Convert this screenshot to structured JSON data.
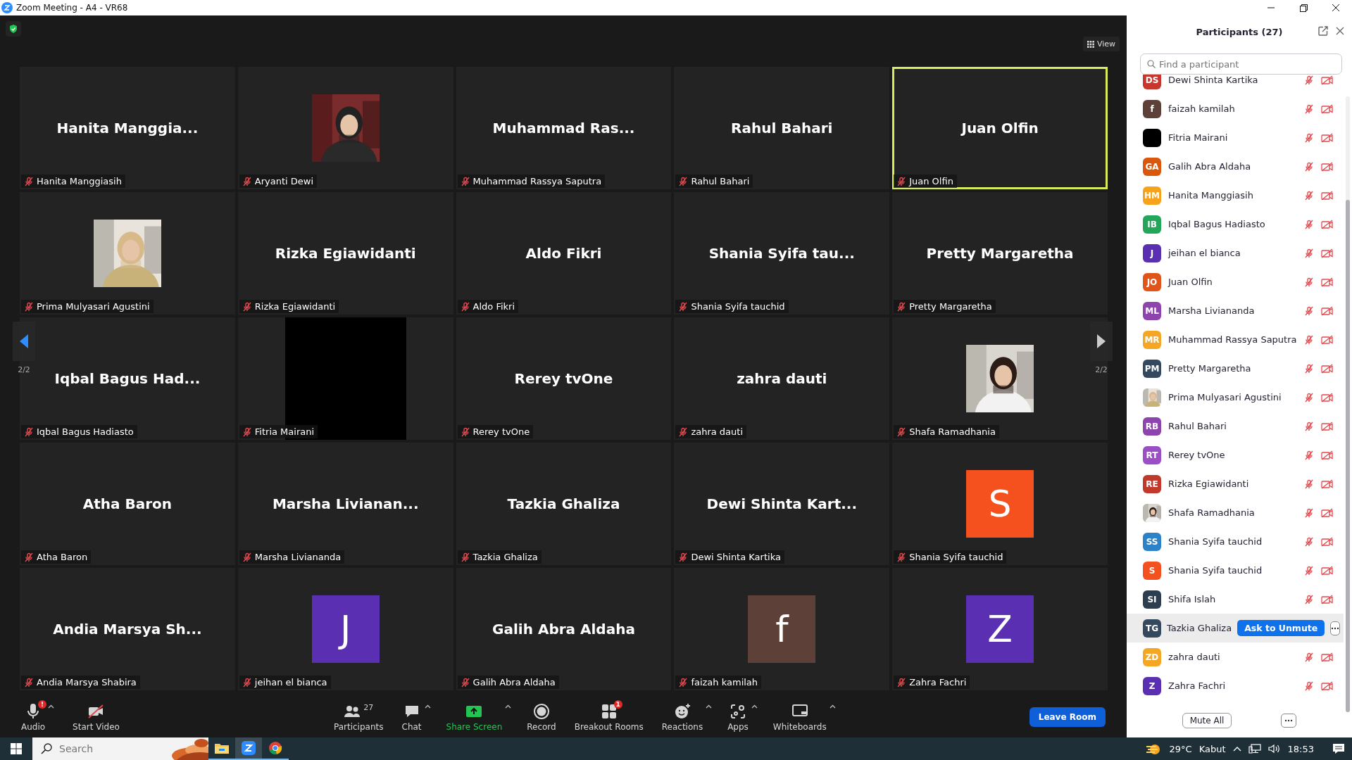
{
  "window": {
    "title": "Zoom Meeting - A4 - VR68"
  },
  "view_button": "View",
  "pager": {
    "left": "2/2",
    "right": "2/2"
  },
  "tiles": [
    {
      "kind": "name",
      "display": "Hanita Manggia...",
      "name": "Hanita Manggiasih",
      "muted": true,
      "speaking": false
    },
    {
      "name": "Aryanti Dewi",
      "muted": true,
      "speaking": false
    },
    {
      "kind": "name",
      "display": "Muhammad Ras...",
      "name": "Muhammad Rassya Saputra",
      "muted": true,
      "speaking": false
    },
    {
      "kind": "name",
      "display": "Rahul Bahari",
      "name": "Rahul Bahari",
      "muted": true,
      "speaking": false
    },
    {
      "kind": "name",
      "display": "Juan Olfin",
      "name": "Juan Olfin",
      "muted": true,
      "speaking": true
    },
    {
      "name": "Prima Mulyasari Agustini",
      "muted": true,
      "speaking": false
    },
    {
      "kind": "name",
      "display": "Rizka Egiawidanti",
      "name": "Rizka Egiawidanti",
      "muted": true,
      "speaking": false
    },
    {
      "kind": "name",
      "display": "Aldo Fikri",
      "name": "Aldo Fikri",
      "muted": true,
      "speaking": false
    },
    {
      "kind": "name",
      "display": "Shania Syifa tau...",
      "name": "Shania Syifa tauchid",
      "muted": true,
      "speaking": false
    },
    {
      "kind": "name",
      "display": "Pretty Margaretha",
      "name": "Pretty Margaretha",
      "muted": true,
      "speaking": false
    },
    {
      "kind": "name",
      "display": "Iqbal Bagus Had...",
      "name": "Iqbal Bagus Hadiasto",
      "muted": true,
      "speaking": false
    },
    {
      "kind": "black",
      "name": "Fitria Mairani",
      "muted": true,
      "speaking": false
    },
    {
      "kind": "name",
      "display": "Rerey tvOne",
      "name": "Rerey tvOne",
      "muted": true,
      "speaking": false
    },
    {
      "kind": "name",
      "display": "zahra dauti",
      "name": "zahra dauti",
      "muted": true,
      "speaking": false
    },
    {
      "name": "Shafa Ramadhania",
      "muted": true,
      "speaking": false
    },
    {
      "kind": "name",
      "display": "Atha Baron",
      "name": "Atha Baron",
      "muted": true,
      "speaking": false
    },
    {
      "kind": "name",
      "display": "Marsha Livianan...",
      "name": "Marsha Liviananda",
      "muted": true,
      "speaking": false
    },
    {
      "kind": "name",
      "display": "Tazkia Ghaliza",
      "name": "Tazkia Ghaliza",
      "muted": true,
      "speaking": false
    },
    {
      "kind": "name",
      "display": "Dewi Shinta Kart...",
      "name": "Dewi Shinta Kartika",
      "muted": true,
      "speaking": false
    },
    {
      "kind": "letter",
      "letter": "S",
      "color": "#f4511e",
      "name": "Shania Syifa tauchid",
      "muted": true,
      "speaking": false
    },
    {
      "kind": "name",
      "display": "Andia Marsya Sh...",
      "name": "Andia Marsya Shabira",
      "muted": true,
      "speaking": false
    },
    {
      "kind": "letter",
      "letter": "J",
      "color": "#5b2fb1",
      "name": "jeihan el bianca",
      "muted": true,
      "speaking": false
    },
    {
      "kind": "name",
      "display": "Galih Abra Aldaha",
      "name": "Galih Abra Aldaha",
      "muted": true,
      "speaking": false
    },
    {
      "kind": "letter",
      "letter": "f",
      "color": "#5d4037",
      "name": "faizah kamilah",
      "muted": true,
      "speaking": false
    },
    {
      "kind": "letter",
      "letter": "Z",
      "color": "#5b2fb1",
      "name": "Zahra Fachri",
      "muted": true,
      "speaking": false
    }
  ],
  "toolbar": [
    {
      "kind": "audio",
      "label": "Audio",
      "badge": "!",
      "caret": true
    },
    {
      "kind": "video",
      "label": "Start Video",
      "caret": false
    },
    {
      "kind": "participants",
      "label": "Participants",
      "count": "27",
      "caret": false
    },
    {
      "kind": "chat",
      "label": "Chat",
      "caret": true
    },
    {
      "kind": "share",
      "label": "Share Screen",
      "caret": true
    },
    {
      "kind": "record",
      "label": "Record",
      "caret": false
    },
    {
      "kind": "breakout",
      "label": "Breakout Rooms",
      "badge": "1",
      "caret": false
    },
    {
      "kind": "reactions",
      "label": "Reactions",
      "caret": true
    },
    {
      "kind": "apps",
      "label": "Apps",
      "caret": true
    },
    {
      "kind": "whiteboards",
      "label": "Whiteboards",
      "caret": true
    }
  ],
  "leave_button": "Leave Room",
  "panel": {
    "title": "Participants (27)",
    "search": {
      "placeholder": "Find a participant"
    },
    "ask_button": "Ask to Unmute",
    "mute_all": "Mute All",
    "participants": [
      {
        "kind": "initials",
        "initials": "DS",
        "color": "#c8372d",
        "name": "Dewi Shinta Kartika",
        "muted": true,
        "video_off": true,
        "hovered": false
      },
      {
        "kind": "initials",
        "initials": "f",
        "color": "#5d4037",
        "name": "faizah kamilah",
        "muted": true,
        "video_off": true,
        "hovered": false
      },
      {
        "kind": "black",
        "name": "Fitria Mairani",
        "muted": true,
        "video_off": true,
        "hovered": false
      },
      {
        "kind": "initials",
        "initials": "GA",
        "color": "#d9580d",
        "name": "Galih Abra Aldaha",
        "muted": true,
        "video_off": true,
        "hovered": false
      },
      {
        "kind": "initials",
        "initials": "HM",
        "color": "#f7a21b",
        "name": "Hanita Manggiasih",
        "muted": true,
        "video_off": true,
        "hovered": false
      },
      {
        "kind": "initials",
        "initials": "IB",
        "color": "#23a55a",
        "name": "Iqbal Bagus Hadiasto",
        "muted": true,
        "video_off": true,
        "hovered": false
      },
      {
        "kind": "initials",
        "initials": "J",
        "color": "#5b2fb1",
        "name": "jeihan el bianca",
        "muted": true,
        "video_off": true,
        "hovered": false
      },
      {
        "kind": "initials",
        "initials": "JO",
        "color": "#e0541a",
        "name": "Juan Olfin",
        "muted": true,
        "video_off": true,
        "hovered": false
      },
      {
        "kind": "initials",
        "initials": "ML",
        "color": "#8e44ad",
        "name": "Marsha Liviananda",
        "muted": true,
        "video_off": true,
        "hovered": false
      },
      {
        "kind": "initials",
        "initials": "MR",
        "color": "#f5a623",
        "name": "Muhammad Rassya Saputra",
        "muted": true,
        "video_off": true,
        "hovered": false
      },
      {
        "kind": "initials",
        "initials": "PM",
        "color": "#34495e",
        "name": "Pretty Margaretha",
        "muted": true,
        "video_off": true,
        "hovered": false
      },
      {
        "name": "Prima Mulyasari Agustini",
        "muted": true,
        "video_off": true,
        "hovered": false
      },
      {
        "kind": "initials",
        "initials": "RB",
        "color": "#8e44ad",
        "name": "Rahul Bahari",
        "muted": true,
        "video_off": true,
        "hovered": false
      },
      {
        "kind": "initials",
        "initials": "RT",
        "color": "#9b4fc4",
        "name": "Rerey tvOne",
        "muted": true,
        "video_off": true,
        "hovered": false
      },
      {
        "kind": "initials",
        "initials": "RE",
        "color": "#c0392b",
        "name": "Rizka Egiawidanti",
        "muted": true,
        "video_off": true,
        "hovered": false
      },
      {
        "name": "Shafa Ramadhania",
        "muted": true,
        "video_off": true,
        "hovered": false
      },
      {
        "kind": "initials",
        "initials": "SS",
        "color": "#2c82c9",
        "name": "Shania Syifa tauchid",
        "muted": true,
        "video_off": true,
        "hovered": false
      },
      {
        "kind": "initials",
        "initials": "S",
        "color": "#f4511e",
        "name": "Shania Syifa tauchid",
        "muted": true,
        "video_off": true,
        "hovered": false
      },
      {
        "kind": "initials",
        "initials": "SI",
        "color": "#2c3e50",
        "name": "Shifa Islah",
        "muted": true,
        "video_off": true,
        "hovered": false
      },
      {
        "kind": "initials",
        "initials": "TG",
        "color": "#34495e",
        "name": "Tazkia Ghaliza",
        "muted": true,
        "video_off": true,
        "hovered": true
      },
      {
        "kind": "initials",
        "initials": "ZD",
        "color": "#f5a623",
        "name": "zahra dauti",
        "muted": true,
        "video_off": true,
        "hovered": false
      },
      {
        "kind": "initials",
        "initials": "Z",
        "color": "#5b2fb1",
        "name": "Zahra Fachri",
        "muted": true,
        "video_off": true,
        "hovered": false
      }
    ]
  },
  "taskbar": {
    "search": {
      "placeholder": "Search"
    },
    "apps": [
      {
        "kind": "folder",
        "selected": false
      },
      {
        "kind": "zoom",
        "selected": true
      },
      {
        "kind": "chrome",
        "selected": false
      }
    ],
    "weather": {
      "temperature": "29°C",
      "condition": "Kabut"
    },
    "time": "18:53"
  }
}
